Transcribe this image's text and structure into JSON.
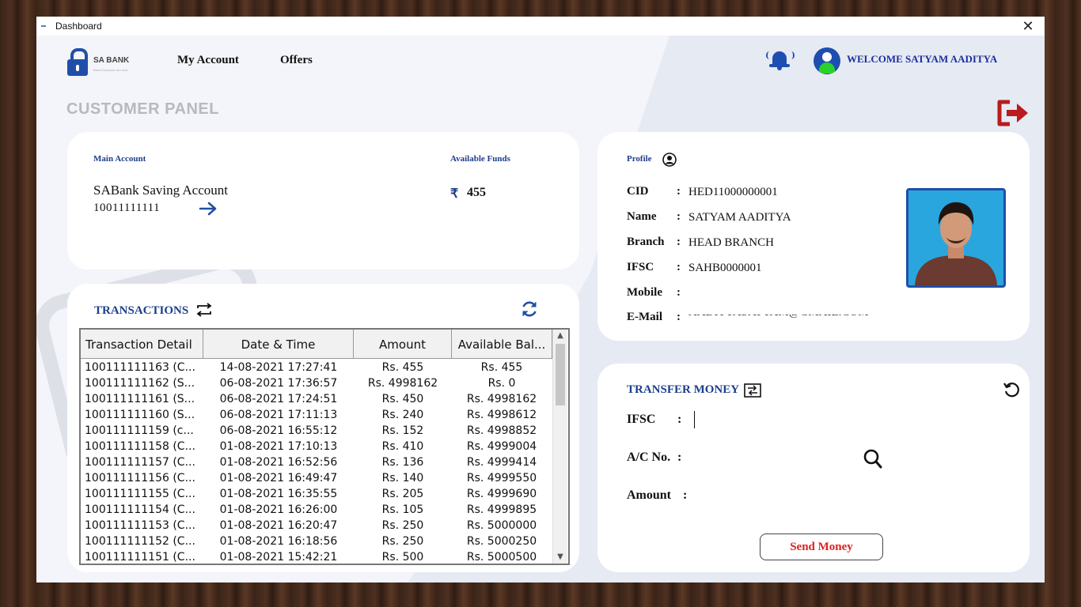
{
  "window": {
    "title": "Dashboard",
    "close_glyph": "✕"
  },
  "header": {
    "logo": {
      "brand": "SA BANK",
      "tagline": "Bank Everyone can trust"
    },
    "nav": [
      "My Account",
      "Offers"
    ],
    "welcome": "WELCOME SATYAM AADITYA"
  },
  "panel_title": "CUSTOMER PANEL",
  "account": {
    "main_label": "Main Account",
    "funds_label": "Available Funds",
    "name": "SABank Saving Account",
    "number": "10011111111",
    "currency_symbol": "₹",
    "funds": "455"
  },
  "transactions": {
    "title": "TRANSACTIONS",
    "columns": [
      "Transaction Detail",
      "Date & Time",
      "Amount",
      "Available Bal..."
    ],
    "rows": [
      [
        "100111111163 (C...",
        "14-08-2021 17:27:41",
        "Rs. 455",
        "Rs. 455"
      ],
      [
        "100111111162 (S...",
        "06-08-2021 17:36:57",
        "Rs. 4998162",
        "Rs. 0"
      ],
      [
        "100111111161 (S...",
        "06-08-2021 17:24:51",
        "Rs. 450",
        "Rs. 4998162"
      ],
      [
        "100111111160 (S...",
        "06-08-2021 17:11:13",
        "Rs. 240",
        "Rs. 4998612"
      ],
      [
        "100111111159 (c...",
        "06-08-2021 16:55:12",
        "Rs. 152",
        "Rs. 4998852"
      ],
      [
        "100111111158 (C...",
        "01-08-2021 17:10:13",
        "Rs. 410",
        "Rs. 4999004"
      ],
      [
        "100111111157 (C...",
        "01-08-2021 16:52:56",
        "Rs. 136",
        "Rs. 4999414"
      ],
      [
        "100111111156 (C...",
        "01-08-2021 16:49:47",
        "Rs. 140",
        "Rs. 4999550"
      ],
      [
        "100111111155 (C...",
        "01-08-2021 16:35:55",
        "Rs. 205",
        "Rs. 4999690"
      ],
      [
        "100111111154 (C...",
        "01-08-2021 16:26:00",
        "Rs. 105",
        "Rs. 4999895"
      ],
      [
        "100111111153 (C...",
        "01-08-2021 16:20:47",
        "Rs. 250",
        "Rs. 5000000"
      ],
      [
        "100111111152 (C...",
        "01-08-2021 16:18:56",
        "Rs. 250",
        "Rs. 5000250"
      ],
      [
        "100111111151 (C...",
        "01-08-2021 15:42:21",
        "Rs. 500",
        "Rs. 5000500"
      ]
    ]
  },
  "profile": {
    "title": "Profile",
    "fields": [
      {
        "label": "CID",
        "value": "HED11000000001"
      },
      {
        "label": "Name",
        "value": "SATYAM AADITYA"
      },
      {
        "label": "Branch",
        "value": "HEAD BRANCH"
      },
      {
        "label": "IFSC",
        "value": "SAHB0000001"
      },
      {
        "label": "Mobile",
        "value": ""
      },
      {
        "label": "E-Mail",
        "value": "AADITYASATYAM@GMAIL.COM"
      }
    ]
  },
  "transfer": {
    "title": "TRANSFER MONEY",
    "ifsc_label": "IFSC",
    "acno_label": "A/C No.",
    "amount_label": "Amount",
    "colon": ":",
    "ifsc_value": "",
    "acno_value": "",
    "amount_value": "",
    "send_label": "Send Money"
  },
  "colors": {
    "brand_blue": "#1f4fa8",
    "title_blue": "#1c3f8c",
    "logout_red": "#b81c1c",
    "send_red": "#e02020",
    "online_green": "#2bd12b"
  },
  "icons": [
    "lock-logo-icon",
    "bell-icon",
    "user-avatar-icon",
    "logout-icon",
    "arrow-right-icon",
    "swap-icon",
    "refresh-icon",
    "user-circle-icon",
    "transfer-icon",
    "reset-icon",
    "search-icon"
  ]
}
